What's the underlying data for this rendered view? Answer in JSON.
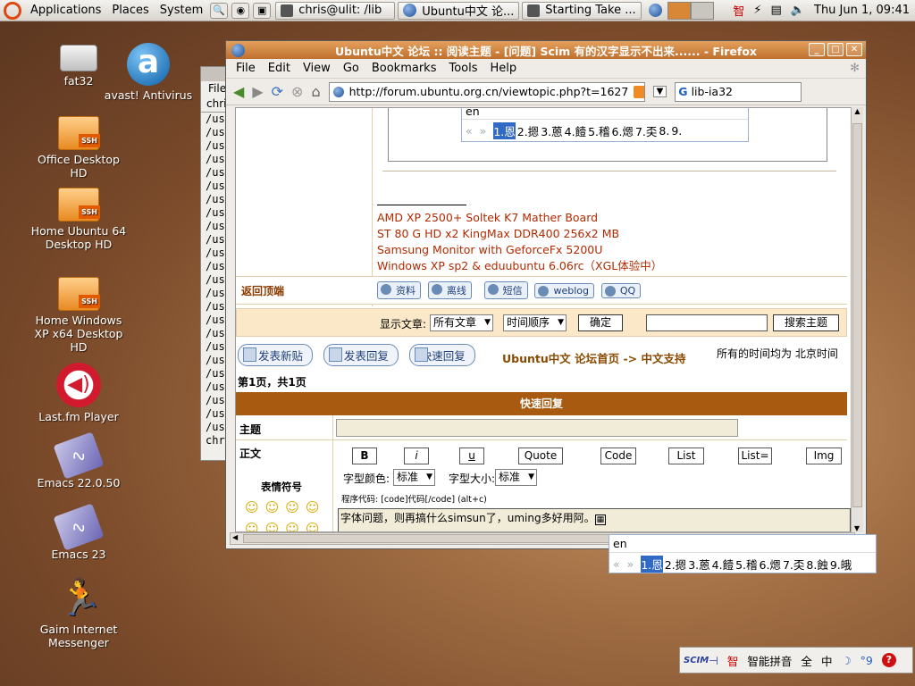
{
  "panel": {
    "menus": [
      "Applications",
      "Places",
      "System"
    ],
    "tasks": [
      "chris@ulit: /lib",
      "Ubuntu中文 论...",
      "Starting Take ..."
    ],
    "clock": "Thu Jun  1, 09:41",
    "tray_zhi": "智"
  },
  "desktop": {
    "icons": [
      {
        "label": "fat32"
      },
      {
        "label": "avast! Antivirus",
        "glyph": "a"
      },
      {
        "label": "Office Desktop HD",
        "badge": "SSH"
      },
      {
        "label": "Home Ubuntu 64 Desktop HD",
        "badge": "SSH"
      },
      {
        "label": "Home Windows XP x64 Desktop HD",
        "badge": "SSH"
      },
      {
        "label": "Last.fm Player"
      },
      {
        "label": "Emacs 22.0.50"
      },
      {
        "label": "Emacs 23"
      },
      {
        "label": "Gaim Internet Messenger"
      }
    ]
  },
  "terminal": {
    "menu_label": "File",
    "tab_label": "chri",
    "lines": [
      "/us",
      "/us",
      "/us",
      "/us",
      "/us",
      "/us",
      "/us",
      "/us",
      "/us",
      "/us",
      "/us",
      "/us",
      "/us",
      "/us",
      "/us",
      "/us",
      "/us",
      "/us",
      "/us",
      "/us",
      "/us",
      "/us",
      "/us",
      "/us"
    ],
    "last_line": "chri"
  },
  "firefox": {
    "title": "Ubuntu中文 论坛 :: 阅读主题 - [问题] Scim 有的汉字显示不出来...... - Firefox",
    "menu": [
      "File",
      "Edit",
      "View",
      "Go",
      "Bookmarks",
      "Tools",
      "Help"
    ],
    "url": "http://forum.ubuntu.org.cn/viewtopic.php?t=1627",
    "search_value": "lib-ia32"
  },
  "forum": {
    "signature": [
      "AMD XP 2500+ Soltek K7 Mather Board",
      "ST 80 G HD x2 KingMax DDR400 256x2 MB",
      "Samsung Monitor with GeforceFx 5200U",
      "Windows XP sp2 & eduubuntu 6.06rc（XGL体验中）"
    ],
    "back_to_top": "返回顶端",
    "profile_buttons": [
      "资料",
      "离线",
      "短信",
      "weblog",
      "QQ"
    ],
    "display_label": "显示文章:",
    "display_select": "所有文章",
    "order_select": "时间顺序",
    "confirm": "确定",
    "search_topic": "搜索主题",
    "new_topic": "发表新贴",
    "post_reply": "发表回复",
    "quick_reply_btn": "快速回复",
    "breadcrumb_home": "Ubuntu中文 论坛首页",
    "breadcrumb_arrow": "->",
    "breadcrumb_forum": "中文支持",
    "timezone": "所有的时间均为 北京时间",
    "page_info": "第1页，共1页",
    "quick_reply_header": "快速回复",
    "subject_label": "主题",
    "body_label": "正文",
    "format_buttons": [
      "B",
      "i",
      "u",
      "Quote",
      "Code",
      "List",
      "List=",
      "Img"
    ],
    "font_color_label": "字型颜色:",
    "font_color_value": "标准",
    "font_size_label": "字型大小:",
    "font_size_value": "标准",
    "code_hint": "程序代码: [code]代码[/code]  (alt+c)",
    "emoticons_label": "表情符号",
    "textarea_text": "字体问题，则再搞什么simsun了，uming多好用阿。"
  },
  "ime_inner": {
    "preedit": "en",
    "candidates": [
      "1.恩",
      "2.摁",
      "3.蒽",
      "4.饐",
      "5.稽",
      "6.煾",
      "7.奀",
      "8.",
      "9."
    ]
  },
  "ime_outer": {
    "preedit": "en",
    "candidates": [
      "1.恩",
      "2.摁",
      "3.蒽",
      "4.饐",
      "5.稽",
      "6.煾",
      "7.奀",
      "8.蝕",
      "9.皒"
    ]
  },
  "scim": {
    "logo": "SCIM",
    "zhi": "智",
    "method": "智能拼音",
    "width": "全",
    "lang": "中",
    "help": "?"
  }
}
